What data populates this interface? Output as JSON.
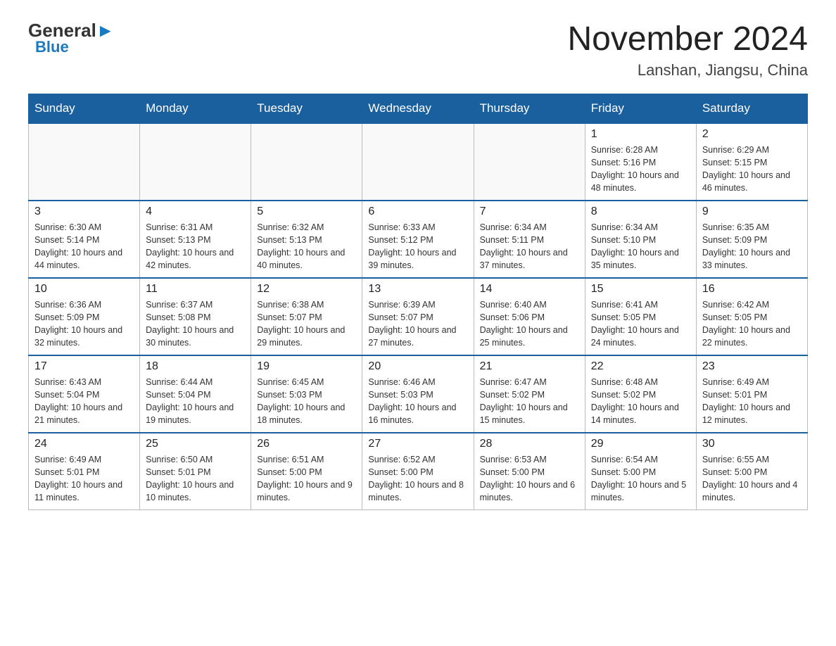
{
  "header": {
    "logo_general": "General",
    "logo_blue": "Blue",
    "month_year": "November 2024",
    "location": "Lanshan, Jiangsu, China"
  },
  "weekdays": [
    "Sunday",
    "Monday",
    "Tuesday",
    "Wednesday",
    "Thursday",
    "Friday",
    "Saturday"
  ],
  "weeks": [
    [
      {
        "day": "",
        "info": ""
      },
      {
        "day": "",
        "info": ""
      },
      {
        "day": "",
        "info": ""
      },
      {
        "day": "",
        "info": ""
      },
      {
        "day": "",
        "info": ""
      },
      {
        "day": "1",
        "info": "Sunrise: 6:28 AM\nSunset: 5:16 PM\nDaylight: 10 hours and 48 minutes."
      },
      {
        "day": "2",
        "info": "Sunrise: 6:29 AM\nSunset: 5:15 PM\nDaylight: 10 hours and 46 minutes."
      }
    ],
    [
      {
        "day": "3",
        "info": "Sunrise: 6:30 AM\nSunset: 5:14 PM\nDaylight: 10 hours and 44 minutes."
      },
      {
        "day": "4",
        "info": "Sunrise: 6:31 AM\nSunset: 5:13 PM\nDaylight: 10 hours and 42 minutes."
      },
      {
        "day": "5",
        "info": "Sunrise: 6:32 AM\nSunset: 5:13 PM\nDaylight: 10 hours and 40 minutes."
      },
      {
        "day": "6",
        "info": "Sunrise: 6:33 AM\nSunset: 5:12 PM\nDaylight: 10 hours and 39 minutes."
      },
      {
        "day": "7",
        "info": "Sunrise: 6:34 AM\nSunset: 5:11 PM\nDaylight: 10 hours and 37 minutes."
      },
      {
        "day": "8",
        "info": "Sunrise: 6:34 AM\nSunset: 5:10 PM\nDaylight: 10 hours and 35 minutes."
      },
      {
        "day": "9",
        "info": "Sunrise: 6:35 AM\nSunset: 5:09 PM\nDaylight: 10 hours and 33 minutes."
      }
    ],
    [
      {
        "day": "10",
        "info": "Sunrise: 6:36 AM\nSunset: 5:09 PM\nDaylight: 10 hours and 32 minutes."
      },
      {
        "day": "11",
        "info": "Sunrise: 6:37 AM\nSunset: 5:08 PM\nDaylight: 10 hours and 30 minutes."
      },
      {
        "day": "12",
        "info": "Sunrise: 6:38 AM\nSunset: 5:07 PM\nDaylight: 10 hours and 29 minutes."
      },
      {
        "day": "13",
        "info": "Sunrise: 6:39 AM\nSunset: 5:07 PM\nDaylight: 10 hours and 27 minutes."
      },
      {
        "day": "14",
        "info": "Sunrise: 6:40 AM\nSunset: 5:06 PM\nDaylight: 10 hours and 25 minutes."
      },
      {
        "day": "15",
        "info": "Sunrise: 6:41 AM\nSunset: 5:05 PM\nDaylight: 10 hours and 24 minutes."
      },
      {
        "day": "16",
        "info": "Sunrise: 6:42 AM\nSunset: 5:05 PM\nDaylight: 10 hours and 22 minutes."
      }
    ],
    [
      {
        "day": "17",
        "info": "Sunrise: 6:43 AM\nSunset: 5:04 PM\nDaylight: 10 hours and 21 minutes."
      },
      {
        "day": "18",
        "info": "Sunrise: 6:44 AM\nSunset: 5:04 PM\nDaylight: 10 hours and 19 minutes."
      },
      {
        "day": "19",
        "info": "Sunrise: 6:45 AM\nSunset: 5:03 PM\nDaylight: 10 hours and 18 minutes."
      },
      {
        "day": "20",
        "info": "Sunrise: 6:46 AM\nSunset: 5:03 PM\nDaylight: 10 hours and 16 minutes."
      },
      {
        "day": "21",
        "info": "Sunrise: 6:47 AM\nSunset: 5:02 PM\nDaylight: 10 hours and 15 minutes."
      },
      {
        "day": "22",
        "info": "Sunrise: 6:48 AM\nSunset: 5:02 PM\nDaylight: 10 hours and 14 minutes."
      },
      {
        "day": "23",
        "info": "Sunrise: 6:49 AM\nSunset: 5:01 PM\nDaylight: 10 hours and 12 minutes."
      }
    ],
    [
      {
        "day": "24",
        "info": "Sunrise: 6:49 AM\nSunset: 5:01 PM\nDaylight: 10 hours and 11 minutes."
      },
      {
        "day": "25",
        "info": "Sunrise: 6:50 AM\nSunset: 5:01 PM\nDaylight: 10 hours and 10 minutes."
      },
      {
        "day": "26",
        "info": "Sunrise: 6:51 AM\nSunset: 5:00 PM\nDaylight: 10 hours and 9 minutes."
      },
      {
        "day": "27",
        "info": "Sunrise: 6:52 AM\nSunset: 5:00 PM\nDaylight: 10 hours and 8 minutes."
      },
      {
        "day": "28",
        "info": "Sunrise: 6:53 AM\nSunset: 5:00 PM\nDaylight: 10 hours and 6 minutes."
      },
      {
        "day": "29",
        "info": "Sunrise: 6:54 AM\nSunset: 5:00 PM\nDaylight: 10 hours and 5 minutes."
      },
      {
        "day": "30",
        "info": "Sunrise: 6:55 AM\nSunset: 5:00 PM\nDaylight: 10 hours and 4 minutes."
      }
    ]
  ]
}
